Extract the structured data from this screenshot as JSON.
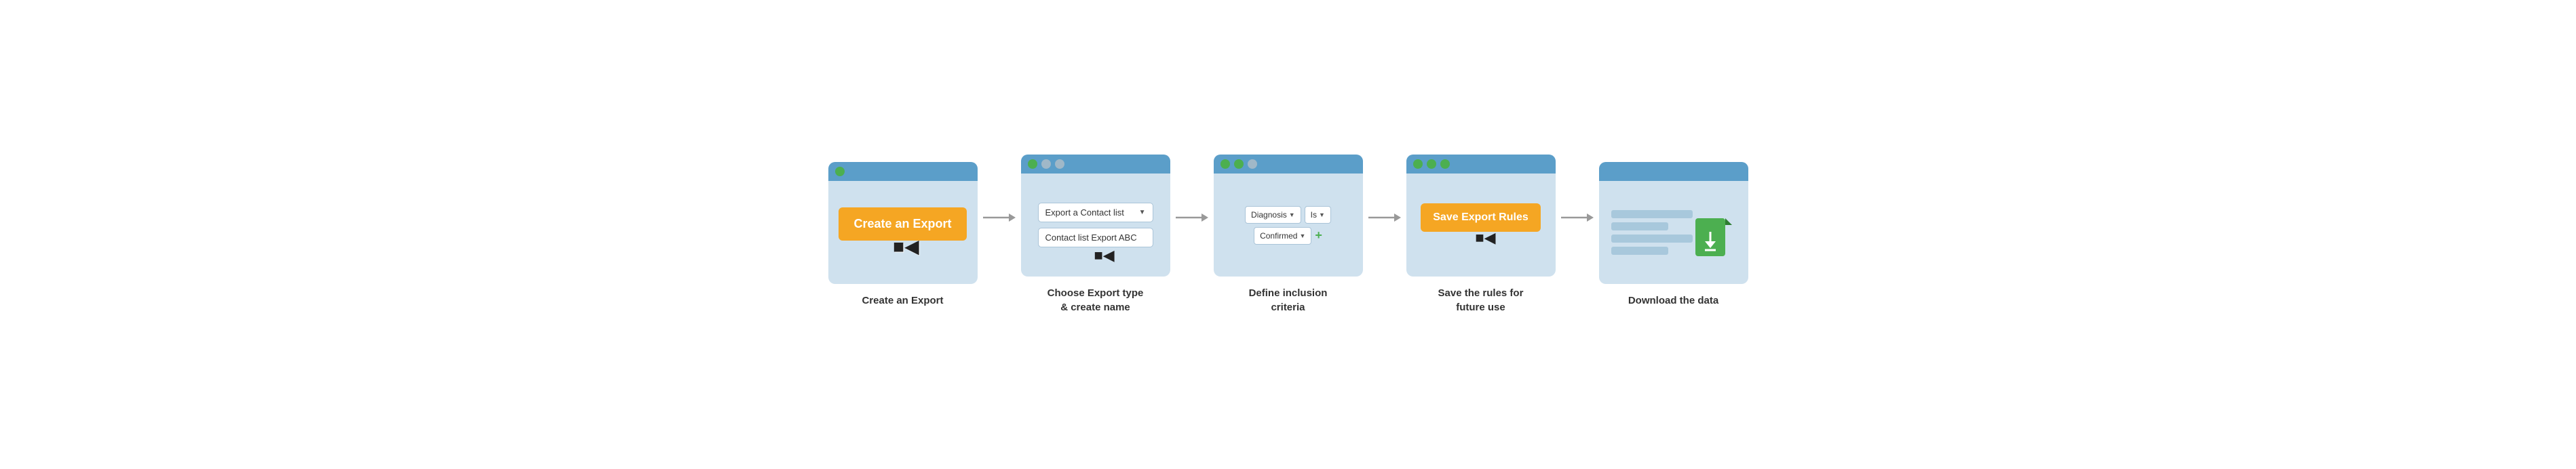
{
  "steps": [
    {
      "id": "step1",
      "label": "Create an Export",
      "dots": [
        "green"
      ],
      "button": "Create an Export",
      "showCursor": true
    },
    {
      "id": "step2",
      "label": "Choose Export type\n& create name",
      "dots": [
        "green",
        "gray",
        "gray"
      ],
      "dropdown_text": "Export a Contact list",
      "text_field": "Contact list Export ABC",
      "showCursor": true
    },
    {
      "id": "step3",
      "label": "Define inclusion\ncriteria",
      "dots": [
        "green",
        "green",
        "gray"
      ],
      "chips": [
        "Diagnosis",
        "Is",
        "Confirmed"
      ],
      "showPlus": true
    },
    {
      "id": "step4",
      "label": "Save the rules for\nfuture use",
      "dots": [
        "green",
        "green",
        "green"
      ],
      "button": "Save Export Rules",
      "showCursor": true
    },
    {
      "id": "step5",
      "label": "Download the data",
      "dots": [],
      "showDoc": true
    }
  ],
  "arrows": 4,
  "colors": {
    "orange": "#f5a623",
    "green": "#4caf50",
    "blue_header": "#5b9ec9",
    "card_bg": "#cfe1ee"
  }
}
